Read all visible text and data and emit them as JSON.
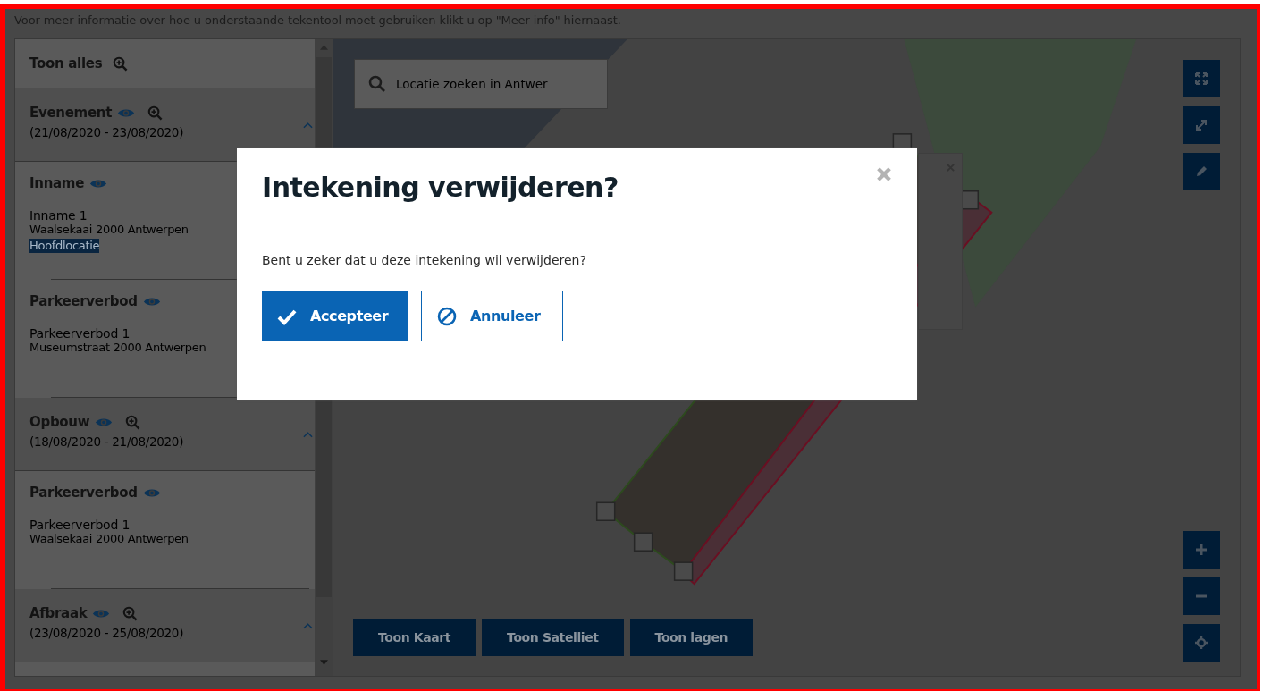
{
  "info_text": "Voor meer informatie over hoe u onderstaande tekentool moet gebruiken klikt u op \"Meer info\" hiernaast.",
  "sidebar": {
    "show_all": {
      "label": "Toon alles"
    },
    "groups": [
      {
        "title": "Evenement",
        "dates": "(21/08/2020 - 23/08/2020)",
        "expanded": true,
        "items": [
          {
            "type": "Inname",
            "name": "Inname 1",
            "address": "Waalsekaai 2000 Antwerpen",
            "tag": "Hoofdlocatie"
          },
          {
            "type": "Parkeerverbod",
            "name": "Parkeerverbod 1",
            "address": "Museumstraat 2000 Antwerpen"
          }
        ]
      },
      {
        "title": "Opbouw",
        "dates": "(18/08/2020 - 21/08/2020)",
        "expanded": true,
        "items": [
          {
            "type": "Parkeerverbod",
            "name": "Parkeerverbod 1",
            "address": "Waalsekaai 2000 Antwerpen"
          }
        ]
      },
      {
        "title": "Afbraak",
        "dates": "(23/08/2020 - 25/08/2020)",
        "expanded": true
      }
    ]
  },
  "map": {
    "search": {
      "placeholder": "Locatie zoeken in Antwer"
    },
    "layer_buttons": [
      "Toon Kaart",
      "Toon Satelliet",
      "Toon lagen"
    ]
  },
  "dialog": {
    "title": "Intekening verwijderen?",
    "message": "Bent u zeker dat u deze intekening wil verwijderen?",
    "buttons": [
      {
        "label": "Accepteer",
        "kind": "primary"
      },
      {
        "label": "Annuleer",
        "kind": "secondary"
      }
    ]
  }
}
